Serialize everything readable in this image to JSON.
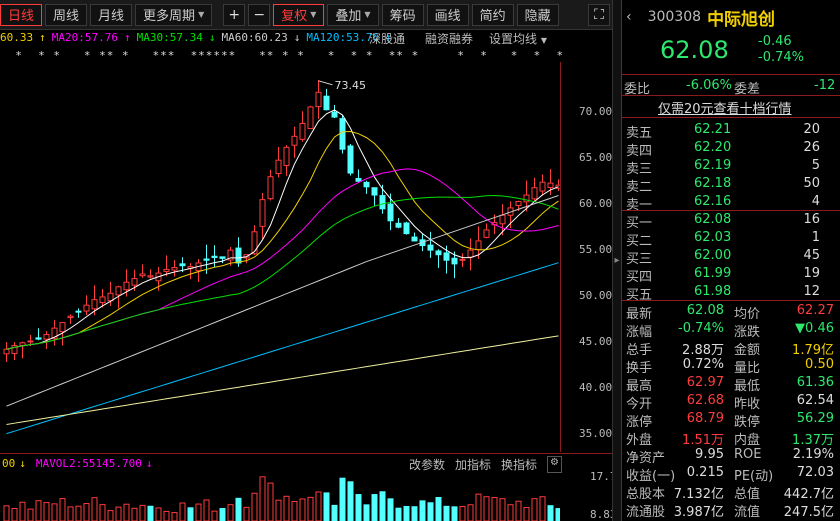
{
  "toolbar": {
    "tabs": [
      "日线",
      "周线",
      "月线",
      "更多周期"
    ],
    "plus": "+",
    "minus": "−",
    "buttons": [
      "复权",
      "叠加",
      "筹码",
      "画线",
      "简约",
      "隐藏"
    ],
    "expand_icon": "expand-icon"
  },
  "ma_legend": {
    "ma10": "60.33",
    "ma20": "MA20:57.76",
    "ma30": "MA30:57.34",
    "ma60": "MA60:60.23",
    "ma120": "MA120:53.76",
    "colors": {
      "ma5": "#ffffff",
      "ma10": "#f0d000",
      "ma20": "#ff00ff",
      "ma30": "#00e000",
      "ma60": "#cccccc",
      "ma120": "#00bfff"
    }
  },
  "chart_tools": [
    "深股通",
    "融资融券",
    "设置均线"
  ],
  "star_row": "  *  * *   * ** *   ***  ******   ** * *   *  * *  ** *     *  *   *  *  *",
  "chart_data": {
    "type": "candlestick",
    "y_ticks": [
      "70.00",
      "65.00",
      "60.00",
      "55.00",
      "50.00",
      "45.00",
      "40.00",
      "35.00"
    ],
    "ylim": [
      33,
      75.5
    ],
    "peak_label": "73.45",
    "closes": [
      44.2,
      44.6,
      44.9,
      45.1,
      45.3,
      45.8,
      46.5,
      47.1,
      47.8,
      48.3,
      49.0,
      49.6,
      49.9,
      50.3,
      51.0,
      51.5,
      51.9,
      52.4,
      52.2,
      52.5,
      52.9,
      53.1,
      53.3,
      53.2,
      53.6,
      53.9,
      54.2,
      54.1,
      55.0,
      53.6,
      54.5,
      57.0,
      60.5,
      63.0,
      64.8,
      66.2,
      67.4,
      68.8,
      70.6,
      72.2,
      70.3,
      69.5,
      66.0,
      63.4,
      62.5,
      61.9,
      61.0,
      59.5,
      58.2,
      57.5,
      56.8,
      56.0,
      55.5,
      55.0,
      54.5,
      53.9,
      53.5,
      54.0,
      55.0,
      56.0,
      57.2,
      58.0,
      58.8,
      59.6,
      60.3,
      61.0,
      61.8,
      62.4,
      62.3,
      62.08
    ]
  },
  "vol_legend": {
    "mavol1": "00",
    "mavol2": "MAVOL2:55145.700"
  },
  "vol_tools": [
    "改参数",
    "加指标",
    "换指标"
  ],
  "vol_y": [
    "17.70",
    "8.83"
  ],
  "panel": {
    "code": "300308",
    "name": "中际旭创",
    "price": "62.08",
    "change": "-0.46",
    "change_pct": "-0.74%",
    "webi_label": "委比",
    "webi": "-6.06%",
    "weicha_label": "委差",
    "weicha": "-12",
    "promo": "仅需20元查看十档行情",
    "asks": [
      {
        "label": "卖五",
        "price": "62.21",
        "vol": "20"
      },
      {
        "label": "卖四",
        "price": "62.20",
        "vol": "26"
      },
      {
        "label": "卖三",
        "price": "62.19",
        "vol": "5"
      },
      {
        "label": "卖二",
        "price": "62.18",
        "vol": "50"
      },
      {
        "label": "卖一",
        "price": "62.16",
        "vol": "4"
      }
    ],
    "bids": [
      {
        "label": "买一",
        "price": "62.08",
        "vol": "16"
      },
      {
        "label": "买二",
        "price": "62.03",
        "vol": "1"
      },
      {
        "label": "买三",
        "price": "62.00",
        "vol": "45"
      },
      {
        "label": "买四",
        "price": "61.99",
        "vol": "19"
      },
      {
        "label": "买五",
        "price": "61.98",
        "vol": "12"
      }
    ],
    "stats": [
      {
        "l1": "最新",
        "v1": "62.08",
        "c1": "g",
        "l2": "均价",
        "v2": "62.27",
        "c2": "r"
      },
      {
        "l1": "涨幅",
        "v1": "-0.74%",
        "c1": "g",
        "l2": "涨跌",
        "v2": "▼0.46",
        "c2": "g"
      },
      {
        "l1": "总手",
        "v1": "2.88万",
        "c1": "w",
        "l2": "金额",
        "v2": "1.79亿",
        "c2": "y"
      },
      {
        "l1": "换手",
        "v1": "0.72%",
        "c1": "w",
        "l2": "量比",
        "v2": "0.50",
        "c2": "y"
      },
      {
        "l1": "最高",
        "v1": "62.97",
        "c1": "r",
        "l2": "最低",
        "v2": "61.36",
        "c2": "g"
      },
      {
        "l1": "今开",
        "v1": "62.68",
        "c1": "r",
        "l2": "昨收",
        "v2": "62.54",
        "c2": "w"
      },
      {
        "l1": "涨停",
        "v1": "68.79",
        "c1": "r",
        "l2": "跌停",
        "v2": "56.29",
        "c2": "g"
      },
      {
        "l1": "外盘",
        "v1": "1.51万",
        "c1": "r",
        "l2": "内盘",
        "v2": "1.37万",
        "c2": "g"
      },
      {
        "l1": "净资产",
        "v1": "9.95",
        "c1": "w",
        "l2": "ROE",
        "v2": "2.19%",
        "c2": "w"
      },
      {
        "l1": "收益(一)",
        "v1": "0.215",
        "c1": "w",
        "l2": "PE(动)",
        "v2": "72.03",
        "c2": "w"
      },
      {
        "l1": "总股本",
        "v1": "7.132亿",
        "c1": "w",
        "l2": "总值",
        "v2": "442.7亿",
        "c2": "w"
      },
      {
        "l1": "流通股",
        "v1": "3.987亿",
        "c1": "w",
        "l2": "流值",
        "v2": "247.5亿",
        "c2": "w"
      }
    ]
  }
}
